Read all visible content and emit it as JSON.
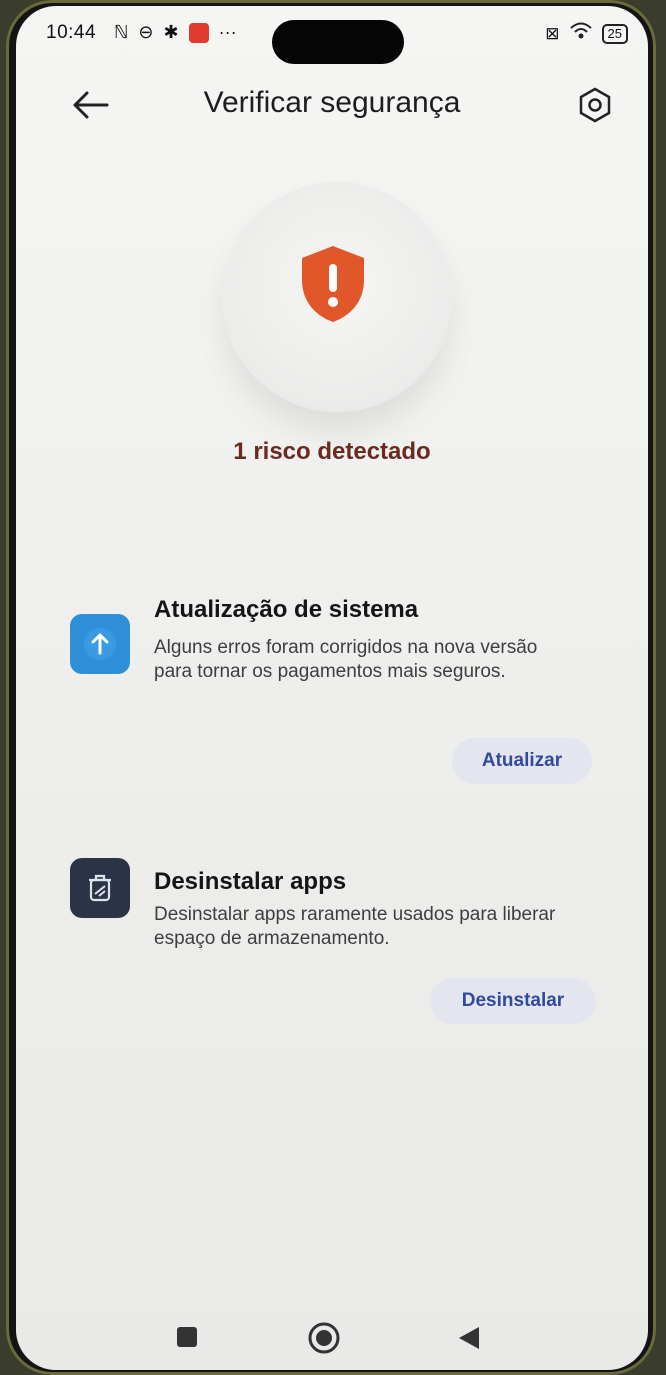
{
  "status_bar": {
    "time": "10:44",
    "battery": "25"
  },
  "header": {
    "title": "Verificar segurança"
  },
  "hero": {
    "risk_text": "1 risco detectado",
    "shield_color": "#e2572a"
  },
  "items": [
    {
      "title": "Atualização de sistema",
      "description": "Alguns erros foram corrigidos na nova versão para tornar os pagamentos mais seguros.",
      "action_label": "Atualizar",
      "icon": "arrow-up-icon",
      "icon_color": "#2e90d8"
    },
    {
      "title": "Desinstalar apps",
      "description": "Desinstalar apps raramente usados para liberar espaço de armazenamento.",
      "action_label": "Desinstalar",
      "icon": "trash-icon",
      "icon_color": "#2b3346"
    }
  ],
  "nav_bar": {
    "recent_icon": "square-icon",
    "home_icon": "circle-icon",
    "back_icon": "triangle-back-icon"
  }
}
